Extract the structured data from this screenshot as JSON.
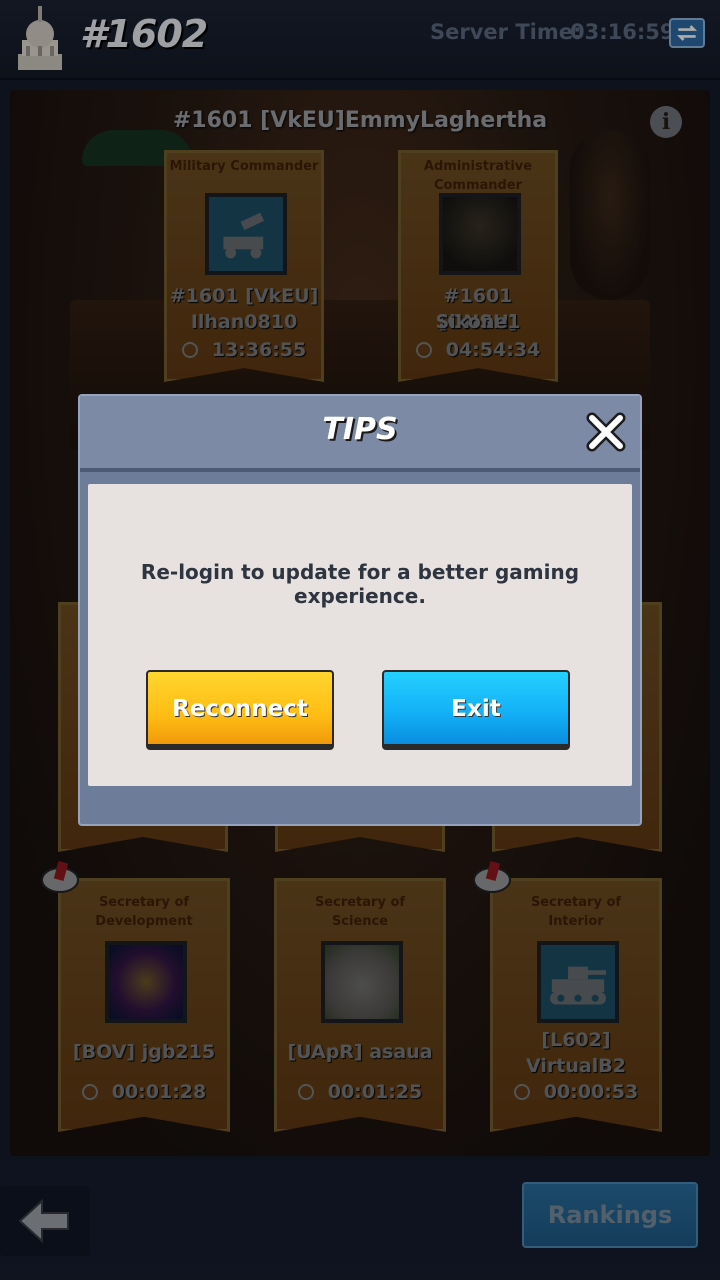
{
  "header": {
    "server_number": "#1602",
    "server_time_label": "Server Time:",
    "server_time_value": "03:16:59"
  },
  "court": {
    "leader": "#1601 [VkEU]EmmyLaghertha",
    "positions": [
      {
        "title": "Military Commander",
        "name_line1": "#1601 [VkEU]",
        "name_line2": "Ilhan0810",
        "timer": "13:36:55",
        "icon": "rocket-launcher-icon"
      },
      {
        "title": "Administrative Commander",
        "name_line1": "#1601 [ONSH]",
        "name_line2": "Sikone1",
        "timer": "04:54:34",
        "icon": "soldier-avatar"
      },
      {
        "title": "Secretary of Development",
        "name_line1": "[BOV] jgb215",
        "name_line2": "",
        "timer": "00:01:28",
        "icon": "cosmic-avatar"
      },
      {
        "title": "Secretary of Science",
        "name_line1": "[UApR] asaua",
        "name_line2": "",
        "timer": "00:01:25",
        "icon": "cat-avatar"
      },
      {
        "title": "Secretary of Interior",
        "name_line1": "[L602]",
        "name_line2": "VirtualB2",
        "timer": "00:00:53",
        "icon": "tank-icon"
      }
    ]
  },
  "footer": {
    "rankings_label": "Rankings"
  },
  "dialog": {
    "title": "TIPS",
    "message": "Re-login to update for a better gaming experience.",
    "reconnect_label": "Reconnect",
    "exit_label": "Exit"
  },
  "colors": {
    "reconnect": "#ffbd14",
    "exit": "#12aef5",
    "dialog_frame": "#6d7c99",
    "dialog_body": "#e7e2df"
  }
}
